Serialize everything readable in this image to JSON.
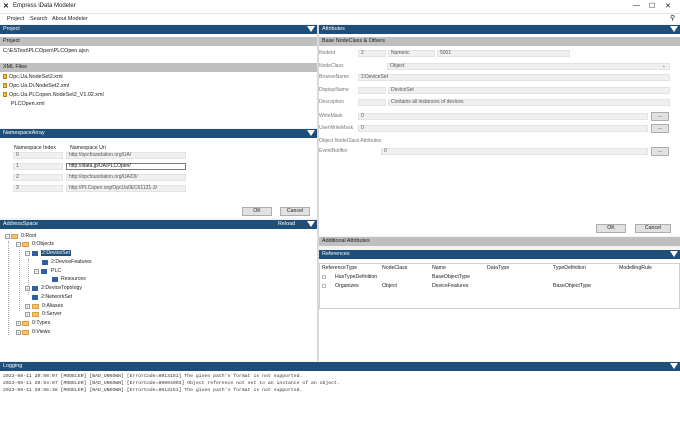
{
  "window": {
    "title": "Empress iData Modeler"
  },
  "menu": [
    "Project",
    "Search",
    "About Modeler"
  ],
  "project_panel": {
    "header": "Project",
    "subheader": "Project",
    "path": "C:\\ESTest\\PLCOpen\\PLCOpen.ajsn",
    "xml_header": "XML Files",
    "xml_files": [
      "Opc.Ua.NodeSet2.xml",
      "Opc.Ua.Di.NodeSet2.xml",
      "Opc.Ua.PLCopen.NodeSet2_V1.02.xml",
      "PLCOpen.xml"
    ]
  },
  "namespace_panel": {
    "header": "NamespaceArray",
    "col_index": "Namespace Index",
    "col_uri": "Namespace Uri",
    "rows": [
      {
        "index": "0",
        "uri": "http://opcfoundation.org/UA/"
      },
      {
        "index": "1",
        "uri": "http://idata.jp/UA/PLCOpen/"
      },
      {
        "index": "2",
        "uri": "http://opcfoundation.org/UA/DI/"
      },
      {
        "index": "3",
        "uri": "http://PLCopen.org/OpcUa/IEC61131-3/"
      }
    ],
    "ok": "OK",
    "cancel": "Cancel"
  },
  "address_panel": {
    "header": "AddressSpace",
    "reload": "Reload",
    "tree": {
      "root": "0:Root",
      "objects": "0:Objects",
      "deviceset": "2:DeviceSet",
      "devicefeatures": "2:DeviceFeatures",
      "plc": "PLC",
      "resources": "Resources",
      "devicetopology": "2:DeviceTopology",
      "networkset": "2:NetworkSet",
      "aliases": "0:Aliases",
      "server": "0:Server",
      "types": "0:Types",
      "views": "0:Views"
    }
  },
  "attributes_panel": {
    "header": "Attributes",
    "subheader": "Base NodeClass & Others",
    "nodeid_label": "NodeId",
    "nodeid_ns": "2",
    "nodeid_type": "Numeric",
    "nodeid_value": "5001",
    "nodeclass_label": "NodeClass",
    "nodeclass_value": "Object",
    "browsename_label": "BrowseName",
    "browsename_value": "2:DeviceSet",
    "displayname_label": "DisplayName",
    "displayname_value": "DeviceSet",
    "description_label": "Description",
    "description_value": "Contains all instances of devices",
    "writemask_label": "WriteMask",
    "writemask_value": "0",
    "userwritemask_label": "UserWriteMask",
    "userwritemask_value": "0",
    "object_attrs_label": "Object NodeClass Attributes",
    "eventnotifier_label": "EventNotifier",
    "eventnotifier_value": "0",
    "more_button": "...",
    "ok": "OK",
    "cancel": "Cancel",
    "additional": "Additional Attributes"
  },
  "references_panel": {
    "header": "References",
    "columns": [
      "ReferenceType",
      "NodeClass",
      "Name",
      "DataType",
      "TypeDefinition",
      "ModellingRule"
    ],
    "rows": [
      {
        "ref": "HasTypeDefinition",
        "nodeclass": "",
        "name": "BaseObjectType",
        "datatype": "",
        "typedef": "",
        "rule": ""
      },
      {
        "ref": "Organizes",
        "nodeclass": "Object",
        "name": "DeviceFeatures",
        "datatype": "",
        "typedef": "BaseObjectType",
        "rule": ""
      }
    ]
  },
  "logging_panel": {
    "header": "Logging",
    "lines": [
      "2023-08-11 20:50:07 [MODELER] [BAD_UNKOWN] [ErrorCode=8013151] The given path's format is not supported.",
      "2023-08-11 20:54:07 [MODELER] [BAD_UNKOWN] [ErrorCode=80004003] Object reference not set to an instance of an object.",
      "2023-08-11 20:56:38 [MODELER] [BAD_UNKOWN] [ErrorCode=8013151] The given path's format is not supported."
    ]
  },
  "colors": {
    "header": "#1f4e79",
    "subheader": "#bfbfbf",
    "selection": "#1f4e79"
  }
}
